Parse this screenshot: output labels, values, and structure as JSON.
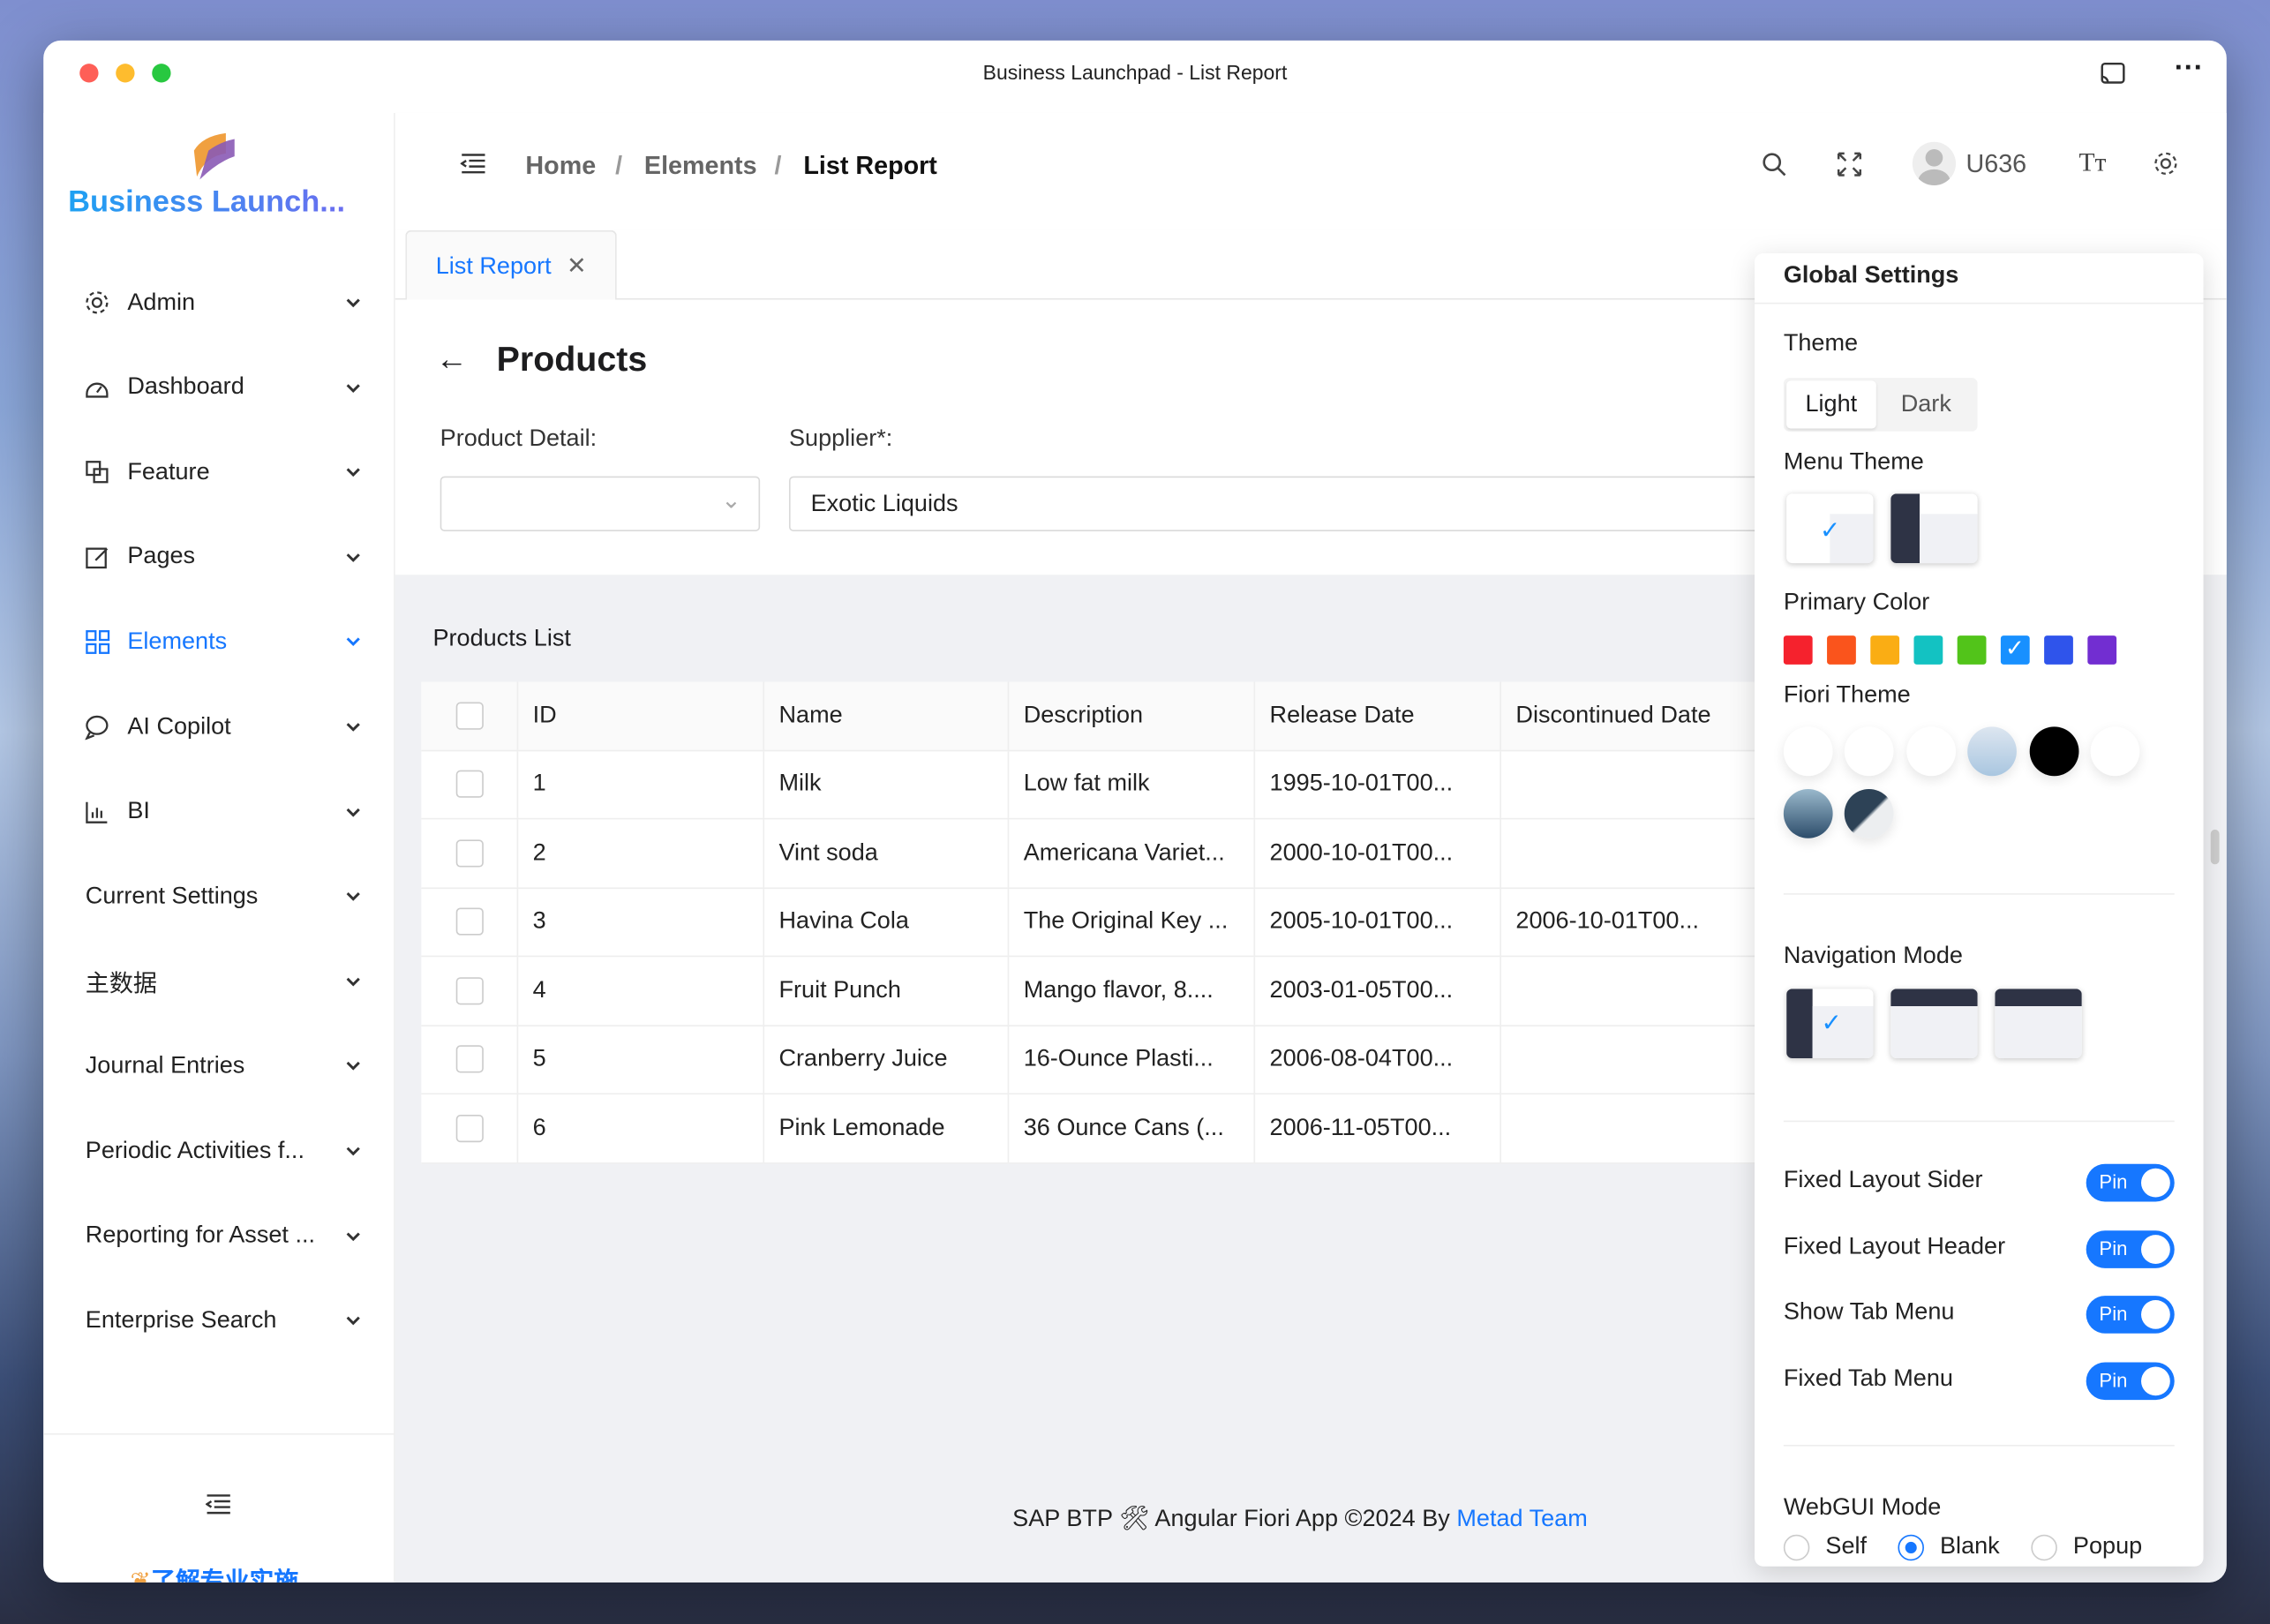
{
  "window": {
    "title": "Business Launchpad - List Report"
  },
  "sidebar": {
    "app_name": "Business Launch...",
    "items": [
      {
        "label": "Admin",
        "icon": "gear-icon"
      },
      {
        "label": "Dashboard",
        "icon": "dashboard-icon"
      },
      {
        "label": "Feature",
        "icon": "feature-icon"
      },
      {
        "label": "Pages",
        "icon": "edit-icon"
      },
      {
        "label": "Elements",
        "icon": "grid-icon",
        "active": true
      },
      {
        "label": "AI Copilot",
        "icon": "chat-icon"
      },
      {
        "label": "BI",
        "icon": "bar-chart-icon"
      },
      {
        "label": "Current Settings"
      },
      {
        "label": "主数据"
      },
      {
        "label": "Journal Entries"
      },
      {
        "label": "Periodic Activities f..."
      },
      {
        "label": "Reporting for Asset ..."
      },
      {
        "label": "Enterprise Search"
      }
    ],
    "footer_link": "了解专业实施"
  },
  "header": {
    "breadcrumb": [
      "Home",
      "Elements",
      "List Report"
    ],
    "user": "U636"
  },
  "tabs": [
    {
      "label": "List Report"
    }
  ],
  "page": {
    "title": "Products",
    "filters": {
      "product_detail_label": "Product Detail:",
      "product_detail_value": "",
      "supplier_label": "Supplier*:",
      "supplier_value": "Exotic Liquids"
    }
  },
  "table": {
    "title": "Products List",
    "columns": [
      "ID",
      "Name",
      "Description",
      "Release Date",
      "Discontinued Date"
    ],
    "rows": [
      [
        "1",
        "Milk",
        "Low fat milk",
        "1995-10-01T00...",
        ""
      ],
      [
        "2",
        "Vint soda",
        "Americana Variet...",
        "2000-10-01T00...",
        ""
      ],
      [
        "3",
        "Havina Cola",
        "The Original Key ...",
        "2005-10-01T00...",
        "2006-10-01T00..."
      ],
      [
        "4",
        "Fruit Punch",
        "Mango flavor, 8....",
        "2003-01-05T00...",
        ""
      ],
      [
        "5",
        "Cranberry Juice",
        "16-Ounce Plasti...",
        "2006-08-04T00...",
        ""
      ],
      [
        "6",
        "Pink Lemonade",
        "36 Ounce Cans (...",
        "2006-11-05T00...",
        ""
      ]
    ]
  },
  "footer": {
    "text": "SAP BTP 🛠 Angular Fiori App ©2024 By ",
    "link": "Metad Team"
  },
  "settings": {
    "title": "Global Settings",
    "theme_label": "Theme",
    "theme_options": [
      "Light",
      "Dark"
    ],
    "theme_selected": "Light",
    "menu_theme_label": "Menu Theme",
    "menu_theme_selected": "light",
    "primary_color_label": "Primary Color",
    "primary_colors": [
      "#f5222d",
      "#fa541c",
      "#faad14",
      "#13c2c2",
      "#52c41a",
      "#1890ff",
      "#2f54eb",
      "#722ed1"
    ],
    "primary_selected": "#1890ff",
    "fiori_theme_label": "Fiori Theme",
    "navigation_mode_label": "Navigation Mode",
    "toggles": [
      {
        "label": "Fixed Layout Sider",
        "on_text": "Pin",
        "on": true
      },
      {
        "label": "Fixed Layout Header",
        "on_text": "Pin",
        "on": true
      },
      {
        "label": "Show Tab Menu",
        "on_text": "Pin",
        "on": true
      },
      {
        "label": "Fixed Tab Menu",
        "on_text": "Pin",
        "on": true
      }
    ],
    "webgui_label": "WebGUI Mode",
    "webgui_options": [
      "Self",
      "Blank",
      "Popup"
    ],
    "webgui_selected": "Blank"
  },
  "colors": {
    "accent": "#1677ff"
  }
}
